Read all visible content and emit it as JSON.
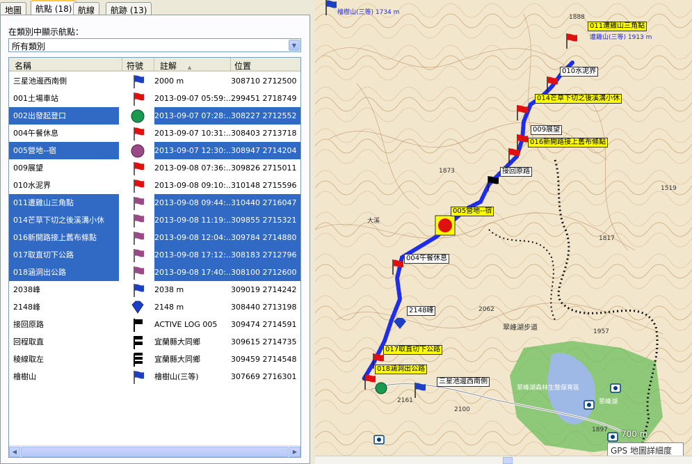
{
  "tabs": [
    {
      "label": "地圖",
      "active": false
    },
    {
      "label": "航點 (18)",
      "active": true
    },
    {
      "label": "航線",
      "active": false
    },
    {
      "label": "航跡 (13)",
      "active": false
    }
  ],
  "filter": {
    "label": "在類別中顯示航點：",
    "value": "所有類別"
  },
  "columns": {
    "name": "名稱",
    "symbol": "符號",
    "comment": "註解",
    "sort_indicator": "▲",
    "position": "位置"
  },
  "waypoints": [
    {
      "name": "三星池邊西南側",
      "icon": "flag-blue",
      "comment": "2000 m",
      "position": "308710 2712500",
      "selected": false
    },
    {
      "name": "001土場車站",
      "icon": "flag-red",
      "comment": "2013-09-07 05:59:...",
      "position": "299451 2718749",
      "selected": false
    },
    {
      "name": "002出發起登口",
      "icon": "circle-green",
      "comment": "2013-09-07 07:28:...",
      "position": "308227 2712552",
      "selected": true
    },
    {
      "name": "004午餐休息",
      "icon": "flag-red",
      "comment": "2013-09-07 10:31:...",
      "position": "308403 2713718",
      "selected": false
    },
    {
      "name": "005營地--宿",
      "icon": "circle-purple",
      "comment": "2013-09-07 12:30:...",
      "position": "308947 2714204",
      "selected": true
    },
    {
      "name": "009展望",
      "icon": "flag-red",
      "comment": "2013-09-08 07:36:...",
      "position": "309826 2715011",
      "selected": false
    },
    {
      "name": "010水泥界",
      "icon": "flag-red",
      "comment": "2013-09-08 09:10:...",
      "position": "310148 2715596",
      "selected": false
    },
    {
      "name": "011遭雞山三角點",
      "icon": "flag-purple",
      "comment": "2013-09-08 09:44:...",
      "position": "310440 2716047",
      "selected": true
    },
    {
      "name": "014芒草下切之後溪溝小休",
      "icon": "flag-purple",
      "comment": "2013-09-08 11:19:...",
      "position": "309855 2715321",
      "selected": true
    },
    {
      "name": "016新開路接上舊布條點",
      "icon": "flag-purple",
      "comment": "2013-09-08 12:04:...",
      "position": "309784 2714880",
      "selected": true
    },
    {
      "name": "017取直切下公路",
      "icon": "flag-purple",
      "comment": "2013-09-08 17:12:...",
      "position": "308183 2712796",
      "selected": true
    },
    {
      "name": "018涵洞出公路",
      "icon": "flag-purple",
      "comment": "2013-09-08 17:40:...",
      "position": "308100 2712600",
      "selected": true
    },
    {
      "name": "2038峰",
      "icon": "flag-blue",
      "comment": "2038 m",
      "position": "309019 2714242",
      "selected": false
    },
    {
      "name": "2148峰",
      "icon": "diamond-blue",
      "comment": "2148 m",
      "position": "308440 2713198",
      "selected": false
    },
    {
      "name": "接回原路",
      "icon": "flag-black-1",
      "comment": "ACTIVE LOG 005",
      "position": "309474 2714591",
      "selected": false
    },
    {
      "name": "回程取直",
      "icon": "flag-black-2",
      "comment": "宜蘭縣大同鄉",
      "position": "309615 2714735",
      "selected": false
    },
    {
      "name": "稜線取左",
      "icon": "flag-black-3",
      "comment": "宜蘭縣大同鄉",
      "position": "309459 2714548",
      "selected": false
    },
    {
      "name": "檜樹山",
      "icon": "flag-blue",
      "comment": "檜樹山(三等)",
      "position": "307669 2716301",
      "selected": false
    }
  ],
  "map": {
    "labels_yellow": [
      "011遭雞山三角點",
      "014芒草下切之後溪溝小休",
      "016新開路接上舊布條點",
      "005營地--宿",
      "017取直切下公路",
      "018涵洞出公路"
    ],
    "labels_white": [
      "010水泥界",
      "009展望",
      "接回原路",
      "004午餐休息",
      "2148峰",
      "三星池邊西南側"
    ],
    "plain_labels": [
      "1888",
      "1873",
      "1519",
      "1817",
      "2062",
      "1957",
      "2161",
      "2100",
      "1897",
      "大溪",
      "翠峰湖步道",
      "翠峰湖森林生態保育區",
      "翠峰湖"
    ],
    "summit_name": "遭雞山(三等) 1913 m",
    "summit2_name": "檜樹山(三等) 1734 m",
    "scale": "700 m",
    "detail_label": "GPS 地圖詳細度"
  },
  "colors": {
    "selection": "#316ac5",
    "track": "#1e2de8",
    "label_yellow": "#ffff00"
  }
}
